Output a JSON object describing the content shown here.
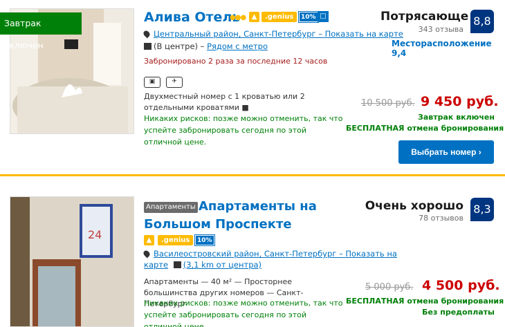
{
  "listings": [
    {
      "breakfast_ribbon": "Завтрак включен",
      "title": "Алива Отель",
      "stars_glyph": "●●●",
      "thumb_icon": "thumbs-up-icon",
      "genius_label": ".genius",
      "discount_label": "10%",
      "gift_icon": "gift-icon",
      "district": "Центральный район, Санкт-Петербург",
      "map_link": "Показать на карте",
      "location_note": "(В центре)",
      "metro_note": "Рядом с метро",
      "booked_note": "Забронировано 2 раза за последние 12 часов",
      "room_description": "Двухместный номер с 1 кроватью или 2 отдельными кроватями",
      "no_risk": "Никаких рисков: позже можно отменить, так что успейте забронировать сегодня по этой отличной цене.",
      "rating_word": "Потрясающе",
      "reviews": "343 отзыва",
      "score": "8,8",
      "location_score": "Месторасположение 9,4",
      "old_price": "10 500 руб.",
      "price": "9 450 руб.",
      "breakfast_included": "Завтрак включен",
      "free_cancel": "БЕСПЛАТНАЯ отмена бронирования",
      "select_button": "Выбрать номер ›"
    },
    {
      "type_tag": "Апартаменты",
      "title_line1": "Апартаменты на",
      "title_line2": "Большом Проспекте",
      "thumb_icon": "thumbs-up-icon",
      "genius_label": ".genius",
      "discount_label": "10%",
      "district": "Василеостровский район, Санкт-Петербург",
      "map_link_part1": "Показать на",
      "map_link_part2": "карте",
      "distance": "(3,1 km от центра)",
      "room_description": "Апартаменты — 40 м² — Просторнее большинства других номеров — Санкт-Петербург",
      "no_risk": "Никаких рисков: позже можно отменить, так что успейте забронировать сегодня по этой отличной цене.",
      "rating_word": "Очень хорошо",
      "reviews": "78 отзывов",
      "score": "8,3",
      "old_price": "5 000 руб.",
      "price": "4 500 руб.",
      "free_cancel": "БЕСПЛАТНАЯ отмена бронирования",
      "no_prepay": "Без предоплаты"
    }
  ],
  "colors": {
    "link_blue": "#0071c2",
    "score_navy": "#003580",
    "genius_yellow": "#febb02",
    "green": "#008009",
    "price_red": "#cc0000"
  }
}
